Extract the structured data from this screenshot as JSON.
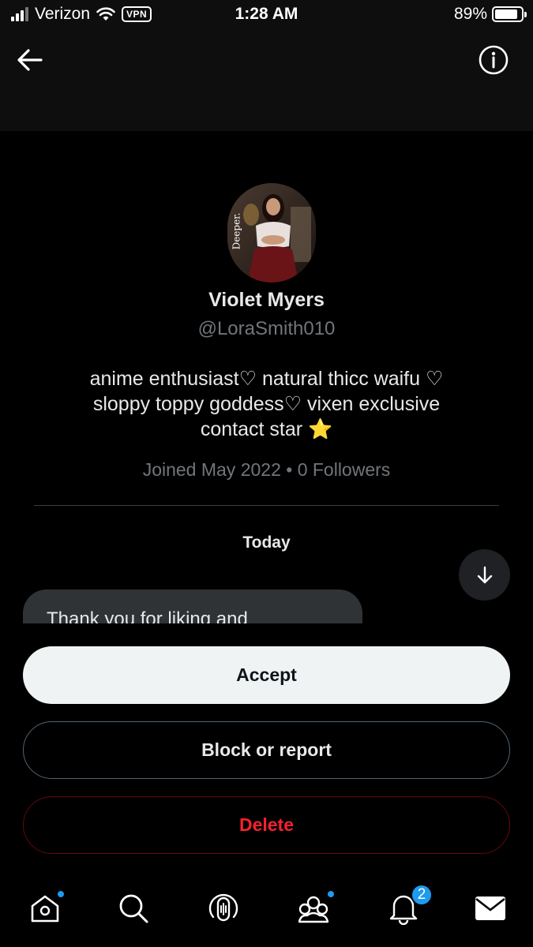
{
  "status_bar": {
    "carrier": "Verizon",
    "vpn": "VPN",
    "time": "1:28 AM",
    "battery": "89%",
    "battery_level": 0.89
  },
  "header": {
    "back_icon": "arrow-left-icon",
    "info_icon": "info-circle-icon"
  },
  "profile": {
    "avatar_watermark": "Deeper.",
    "name": "Violet Myers",
    "handle": "@LoraSmith010",
    "bio_lines": [
      "anime enthusiast♡ natural thicc waifu ♡",
      "sloppy toppy goddess♡ vixen exclusive",
      "contact star ⭐"
    ],
    "meta": "Joined May 2022 • 0 Followers"
  },
  "conversation": {
    "date_label": "Today",
    "message_preview": "Thank you for liking and",
    "scroll_icon": "arrow-down-icon"
  },
  "actions": {
    "accept": "Accept",
    "block": "Block or report",
    "delete": "Delete"
  },
  "nav": {
    "items": [
      "home-icon",
      "search-icon",
      "spaces-icon",
      "communities-icon",
      "notifications-icon",
      "messages-icon"
    ],
    "notifications_badge": "2"
  },
  "colors": {
    "accent": "#1d9bf0",
    "danger": "#f4212e",
    "muted": "#71767b"
  }
}
